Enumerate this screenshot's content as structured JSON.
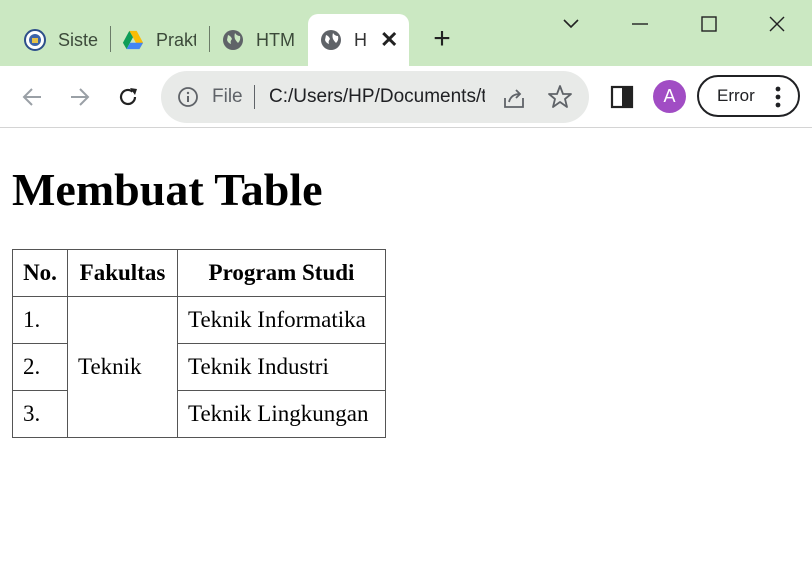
{
  "browser": {
    "tabs": [
      {
        "title": "Sistem",
        "icon": "university-seal-icon"
      },
      {
        "title": "Praktikum",
        "icon": "google-drive-icon"
      },
      {
        "title": "HTML",
        "icon": "globe-icon"
      },
      {
        "title": "H",
        "icon": "globe-icon",
        "active": true
      }
    ],
    "omnibox": {
      "scheme_label": "File",
      "url": "C:/Users/HP/Documents/tabel.html"
    },
    "avatar_letter": "A",
    "error_label": "Error",
    "colors": {
      "tabstrip_bg": "#cbe8c2",
      "omnibox_bg": "#e8eae8",
      "avatar_bg": "#a14dc4"
    }
  },
  "page": {
    "heading": "Membuat Table",
    "table": {
      "headers": [
        "No.",
        "Fakultas",
        "Program Studi"
      ],
      "rows": [
        {
          "no": "1.",
          "program": "Teknik Informatika"
        },
        {
          "no": "2.",
          "program": "Teknik Industri"
        },
        {
          "no": "3.",
          "program": "Teknik Lingkungan"
        }
      ],
      "fakultas_merged": "Teknik"
    }
  }
}
